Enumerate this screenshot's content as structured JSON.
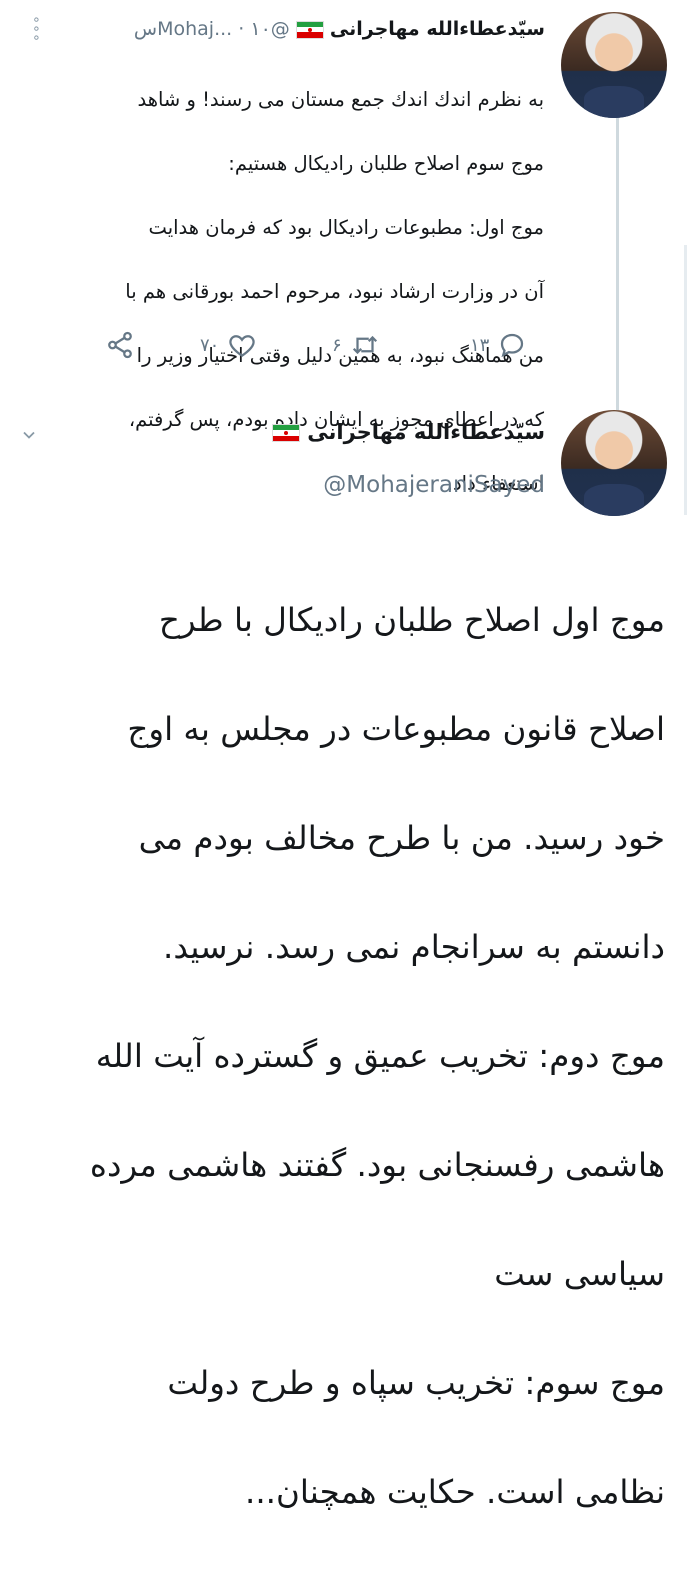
{
  "tweet1": {
    "author_name": "سیّدعطاءالله مهاجرانی",
    "handle": "@Mohaj...",
    "separator": "·",
    "time": "۱۰س",
    "text_lines": [
      "به نظرم اندك اندك جمع مستان می رسند! و شاهد",
      "موج سوم اصلاح طلبان رادیکال هستیم:",
      "موج اول: مطبوعات رادیکال بود که فرمان هدایت",
      "آن در وزارت ارشاد نبود، مرحوم احمد بورقانی هم با",
      "من هماهنگ نبود، به همین دلیل وقتی اختیار وزیر را",
      "که در اعطای مجوز به ایشان داده بودم، پس گرفتم،",
      "استعفاء داد."
    ],
    "replies": "۱۳",
    "retweets": "۶",
    "likes": "۷۰"
  },
  "tweet2": {
    "author_name": "سیّدعطاءالله مهاجرانی",
    "handle": "@MohajeraniSayed",
    "text_lines": [
      "موج اول اصلاح طلبان رادیکال با طرح",
      "اصلاح قانون مطبوعات در مجلس به اوج",
      "خود رسید. من با طرح مخالف بودم می",
      "دانستم به سرانجام نمی رسد. نرسید.",
      "موج دوم: تخریب عمیق و گسترده آیت الله",
      "هاشمی رفسنجانی بود. گفتند هاشمی مرده",
      "سیاسی ست",
      "موج سوم: تخریب سپاه و طرح دولت",
      "نظامی است. حکایت همچنان..."
    ]
  },
  "colors": {
    "text": "#14171a",
    "muted": "#657786",
    "thread_line": "#cfd9de"
  }
}
